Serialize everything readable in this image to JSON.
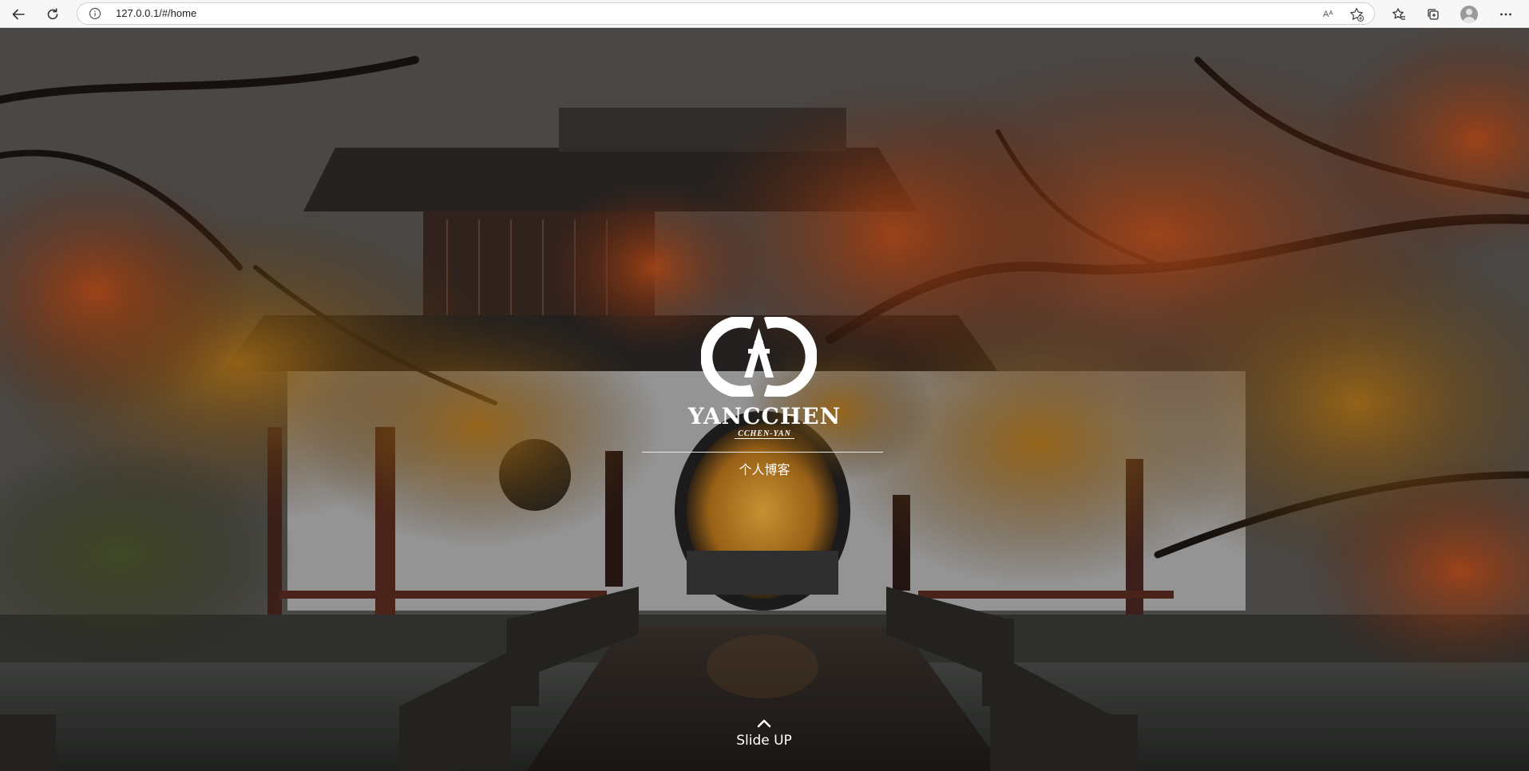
{
  "browser": {
    "url": "127.0.0.1/#/home",
    "read_aloud_glyph": "Aᴬ",
    "icons": [
      "back-icon",
      "refresh-icon",
      "info-icon",
      "read-aloud-icon",
      "add-favorite-icon",
      "favorites-icon",
      "collections-icon",
      "profile-icon",
      "more-icon"
    ]
  },
  "hero": {
    "brand_name": "YANCCHEN",
    "brand_sub": "CCHEN-YAN",
    "tagline": "个人博客",
    "slide_up_label": "Slide UP"
  },
  "colors": {
    "text": "#ffffff",
    "chrome_bg": "#f7f7f7"
  }
}
